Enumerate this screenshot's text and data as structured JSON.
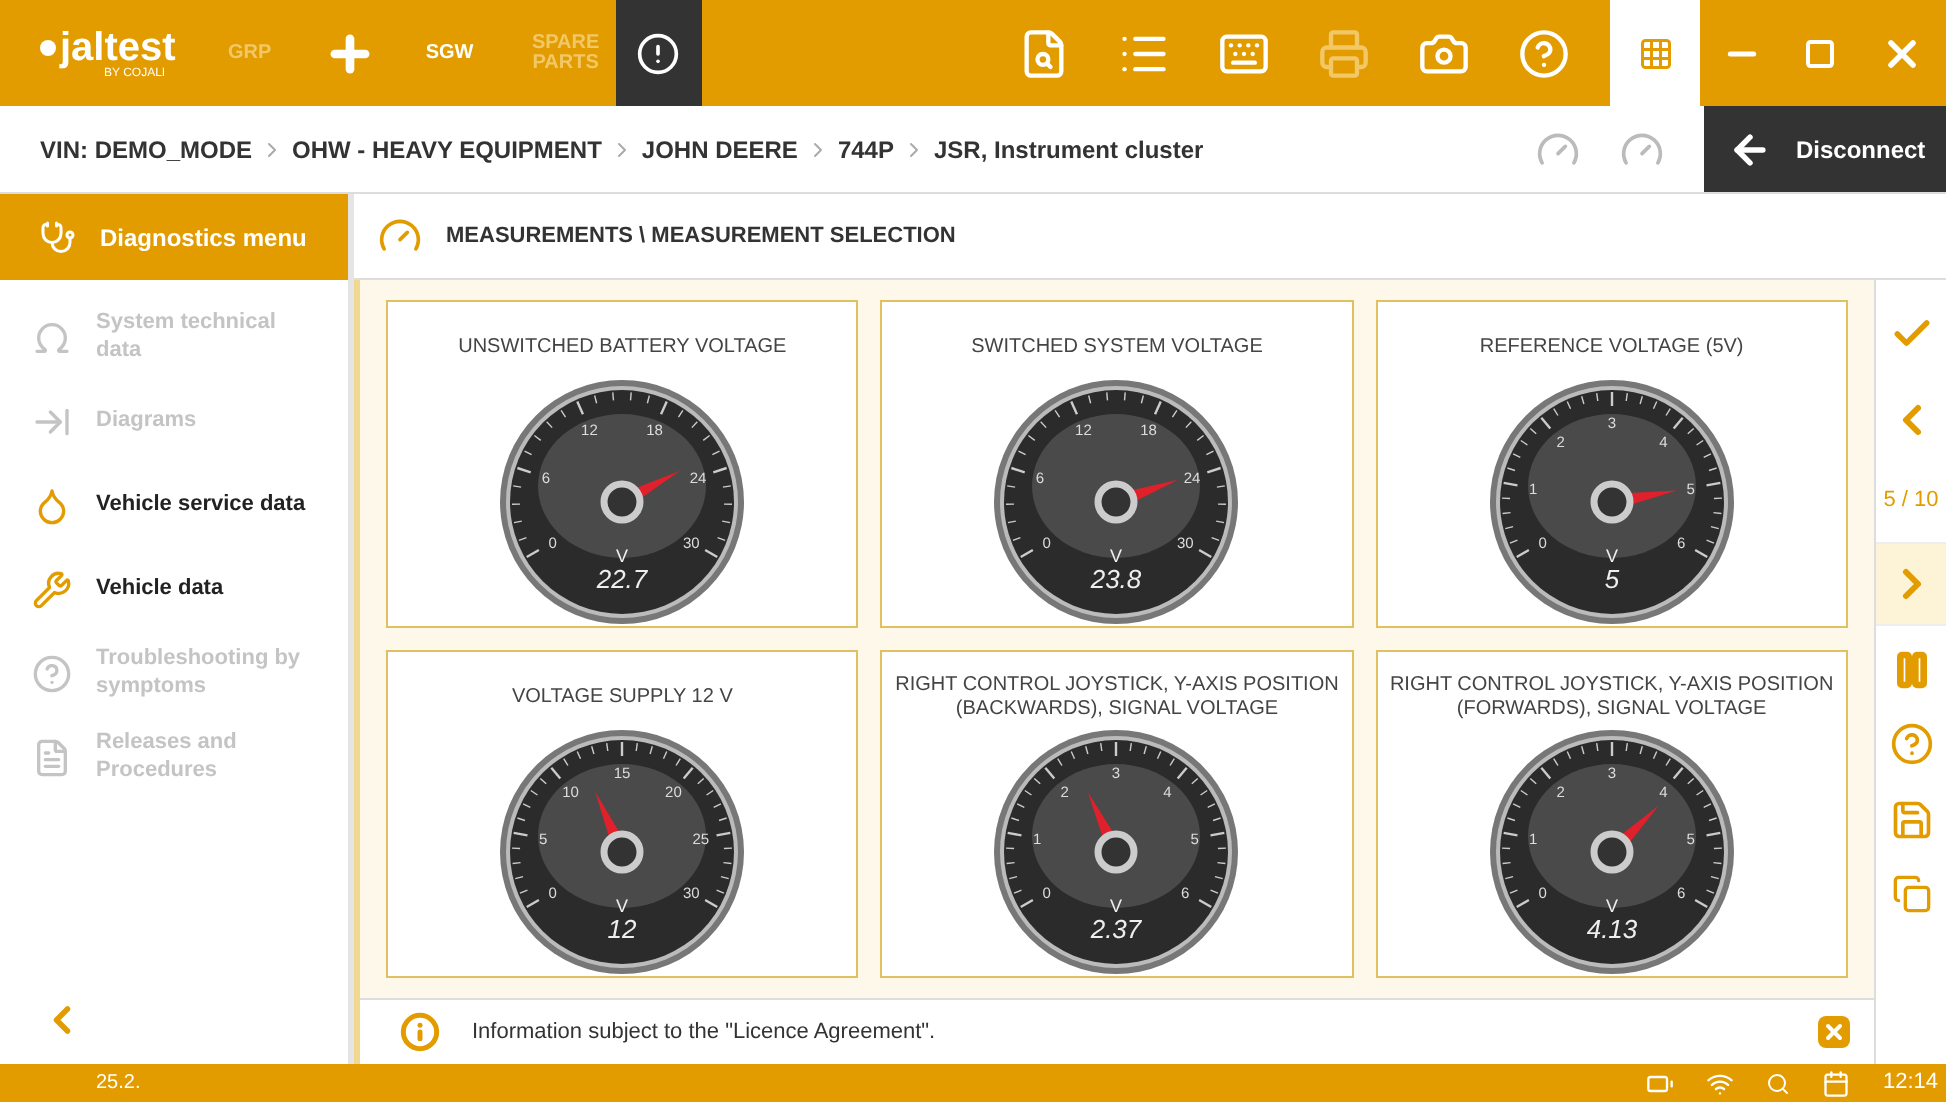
{
  "app": {
    "logo": "jaltest",
    "logo_sub": "BY COJALI"
  },
  "modules": [
    {
      "label": "GRP",
      "disabled": true
    },
    {
      "label": "SGW",
      "disabled": false
    },
    {
      "label": "SPARE PARTS",
      "disabled": true
    }
  ],
  "breadcrumb": [
    "VIN: DEMO_MODE",
    "OHW - HEAVY EQUIPMENT",
    "JOHN DEERE",
    "744P",
    "JSR, Instrument cluster"
  ],
  "disconnect": "Disconnect",
  "sidebar": {
    "title": "Diagnostics menu",
    "items": [
      {
        "kind": "omega",
        "label": "System technical data",
        "disabled": true
      },
      {
        "kind": "diagram",
        "label": "Diagrams",
        "disabled": true
      },
      {
        "kind": "oil",
        "label": "Vehicle service data",
        "disabled": false
      },
      {
        "kind": "wrench",
        "label": "Vehicle data",
        "disabled": false
      },
      {
        "kind": "trouble",
        "label": "Troubleshooting by symptoms",
        "disabled": true
      },
      {
        "kind": "doc",
        "label": "Releases and Procedures",
        "disabled": true
      }
    ]
  },
  "section_title": "MEASUREMENTS \\ MEASUREMENT SELECTION",
  "gauges": [
    {
      "title": "UNSWITCHED BATTERY VOLTAGE",
      "ticks": [
        "0",
        "6",
        "12",
        "18",
        "24",
        "30"
      ],
      "unit": "V",
      "reading": "22.7",
      "level": 0.757
    },
    {
      "title": "SWITCHED SYSTEM VOLTAGE",
      "ticks": [
        "0",
        "6",
        "12",
        "18",
        "24",
        "30"
      ],
      "unit": "V",
      "reading": "23.8",
      "level": 0.793
    },
    {
      "title": "REFERENCE VOLTAGE (5V)",
      "ticks": [
        "0",
        "1",
        "2",
        "3",
        "4",
        "5",
        "6"
      ],
      "unit": "V",
      "reading": "5",
      "level": 0.833
    },
    {
      "title": "VOLTAGE SUPPLY 12 V",
      "ticks": [
        "0",
        "5",
        "10",
        "15",
        "20",
        "25",
        "30"
      ],
      "unit": "V",
      "reading": "12",
      "level": 0.4
    },
    {
      "title": "RIGHT CONTROL JOYSTICK, Y-AXIS POSITION (BACKWARDS), SIGNAL VOLTAGE",
      "ticks": [
        "0",
        "1",
        "2",
        "3",
        "4",
        "5",
        "6"
      ],
      "unit": "V",
      "reading": "2.37",
      "level": 0.395
    },
    {
      "title": "RIGHT CONTROL JOYSTICK, Y-AXIS POSITION (FORWARDS), SIGNAL VOLTAGE",
      "ticks": [
        "0",
        "1",
        "2",
        "3",
        "4",
        "5",
        "6"
      ],
      "unit": "V",
      "reading": "4.13",
      "level": 0.688
    }
  ],
  "pager": "5 / 10",
  "info": "Information subject to the \"Licence Agreement\".",
  "status_bar": {
    "date": "25.2.",
    "time": "12:14"
  }
}
